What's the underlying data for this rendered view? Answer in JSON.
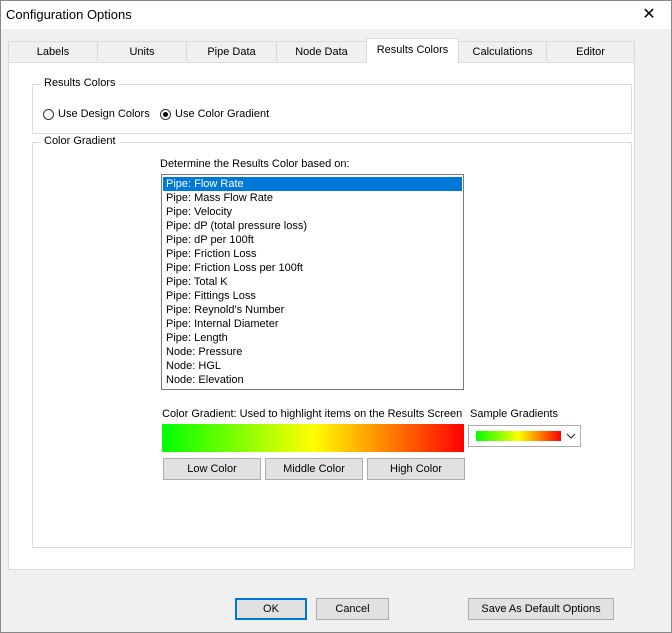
{
  "window": {
    "title": "Configuration Options"
  },
  "tabs": [
    {
      "label": "Labels"
    },
    {
      "label": "Units"
    },
    {
      "label": "Pipe Data"
    },
    {
      "label": "Node Data"
    },
    {
      "label": "Results Colors",
      "active": true
    },
    {
      "label": "Calculations"
    },
    {
      "label": "Editor"
    }
  ],
  "results_colors": {
    "group_label": "Results Colors",
    "options": [
      {
        "label": "Use Design Colors",
        "checked": false
      },
      {
        "label": "Use Color Gradient",
        "checked": true
      }
    ]
  },
  "color_gradient": {
    "group_label": "Color Gradient",
    "prompt": "Determine the Results Color based on:",
    "items": [
      "Pipe: Flow Rate",
      "Pipe: Mass Flow Rate",
      "Pipe: Velocity",
      "Pipe: dP (total pressure loss)",
      "Pipe: dP per 100ft",
      "Pipe: Friction Loss",
      "Pipe: Friction Loss per 100ft",
      "Pipe: Total K",
      "Pipe: Fittings Loss",
      "Pipe: Reynold's Number",
      "Pipe: Internal Diameter",
      "Pipe: Length",
      "Node: Pressure",
      "Node: HGL",
      "Node: Elevation"
    ],
    "selected_index": 0,
    "gradient_caption": "Color Gradient: Used to highlight items on the Results Screen",
    "sample_label": "Sample Gradients",
    "gradient_colors": [
      "#00ff00",
      "#ffff00",
      "#ff0000"
    ],
    "low_button": "Low Color",
    "middle_button": "Middle Color",
    "high_button": "High Color"
  },
  "footer": {
    "ok": "OK",
    "cancel": "Cancel",
    "save_default": "Save As Default Options"
  }
}
